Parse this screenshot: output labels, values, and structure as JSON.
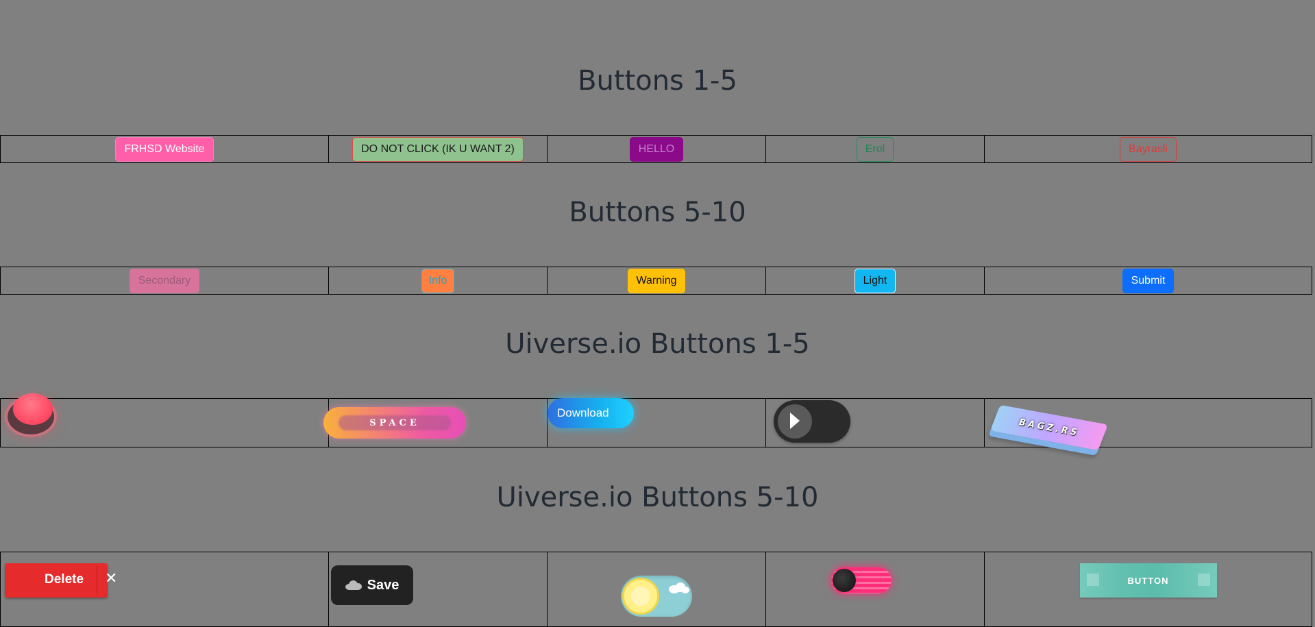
{
  "sections": [
    {
      "title": "Buttons 1-5"
    },
    {
      "title": "Buttons 5-10"
    },
    {
      "title": "Uiverse.io Buttons 1-5"
    },
    {
      "title": "Uiverse.io Buttons 5-10"
    }
  ],
  "buttons_row1": {
    "frhsd": "FRHSD Website",
    "do_not_click": "DO NOT CLICK (IK U WANT 2)",
    "hello": "HELLO",
    "erol": "Erol",
    "bayrasli": "Bayrasli"
  },
  "buttons_row2": {
    "secondary": "Secondary",
    "info": "Info",
    "warning": "Warning",
    "light": "Light",
    "submit": "Submit"
  },
  "uiverse_row1": {
    "space": "SPACE",
    "download": "Download",
    "bagz": "BAGZ.RS"
  },
  "uiverse_row2": {
    "delete": "Delete",
    "delete_close": "✕",
    "save": "Save",
    "button": "BUTTON"
  },
  "colors": {
    "background": "#808080",
    "title": "#222a33",
    "primary": "#0d6efd",
    "warning": "#ffc107",
    "danger": "#e52b2b"
  }
}
